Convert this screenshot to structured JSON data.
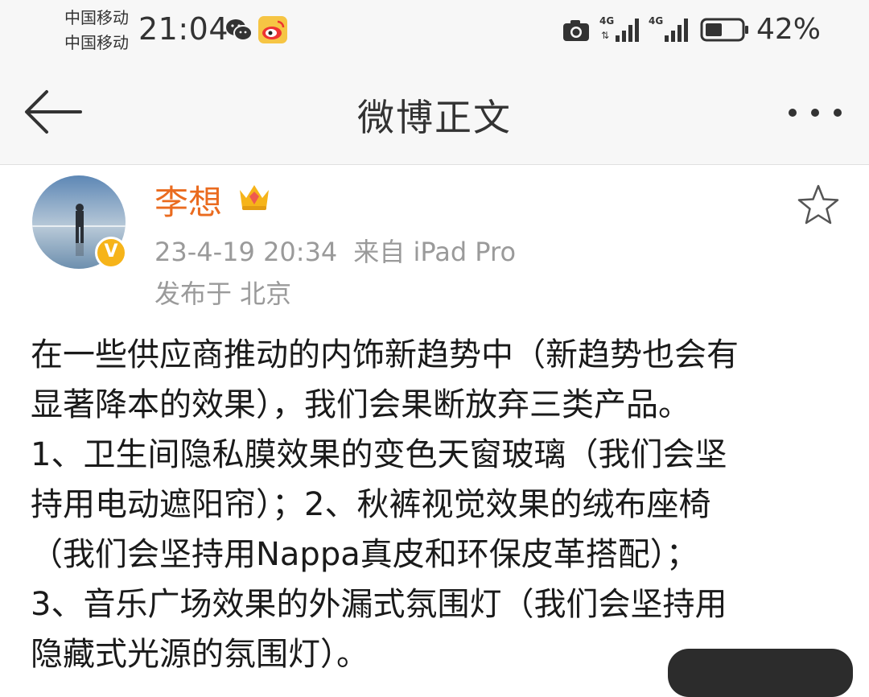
{
  "status_bar": {
    "carrier_1": "中国移动",
    "carrier_2": "中国移动",
    "time": "21:04",
    "battery": "42%",
    "icons": [
      "wechat-icon",
      "weibo-icon",
      "camera-icon",
      "signal-4g-icon",
      "signal-4g-icon",
      "battery-icon"
    ]
  },
  "nav": {
    "title": "微博正文",
    "back_icon": "arrow-left-icon",
    "more_icon": "more-dots-icon"
  },
  "post": {
    "author": "李想",
    "verified": "V",
    "time": "23-4-19 20:34",
    "source": "来自 iPad Pro",
    "location": "发布于 北京",
    "lines": [
      "在一些供应商推动的内饰新趋势中（新趋势也会有",
      "显著降本的效果），我们会果断放弃三类产品。",
      "1、卫生间隐私膜效果的变色天窗玻璃（我们会坚",
      "持用电动遮阳帘）；2、秋裤视觉效果的绒布座椅",
      "（我们会坚持用Nappa真皮和环保皮革搭配）；",
      "3、音乐广场效果的外漏式氛围灯（我们会坚持用",
      "隐藏式光源的氛围灯）。"
    ]
  },
  "colors": {
    "author": "#ea6b1f",
    "meta": "#9a9a9a",
    "badge": "#f6b41a"
  }
}
